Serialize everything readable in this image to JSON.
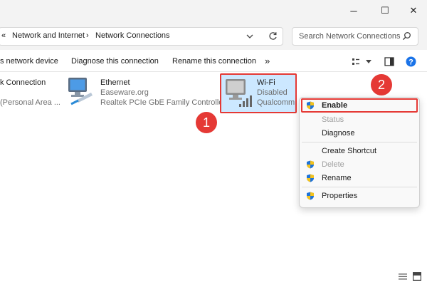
{
  "window": {
    "minimize_glyph": "─",
    "maximize_glyph": "☐",
    "close_glyph": "✕"
  },
  "address": {
    "overflow_glyph": "«",
    "crumbs": [
      "Network and Internet",
      "Network Connections"
    ],
    "separator": "›",
    "search_placeholder": "Search Network Connections"
  },
  "toolbar": {
    "items": [
      "s network device",
      "Diagnose this connection",
      "Rename this connection"
    ],
    "more_glyph": "»"
  },
  "connections": [
    {
      "name": "k Connection",
      "line2": "(Personal Area ..."
    },
    {
      "name": "Ethernet",
      "line2": "Easeware.org",
      "line3": "Realtek PCIe GbE Family Controller"
    },
    {
      "name": "Wi-Fi",
      "line2": "Disabled",
      "line3": "Qualcomm"
    }
  ],
  "annotations": {
    "step1": "1",
    "step2": "2"
  },
  "context_menu": {
    "enable": "Enable",
    "status": "Status",
    "diagnose": "Diagnose",
    "create_shortcut": "Create Shortcut",
    "delete": "Delete",
    "rename": "Rename",
    "properties": "Properties"
  },
  "colors": {
    "selection": "#cce8ff",
    "highlight": "#e53935",
    "disabled_text": "#a0a0a0",
    "help": "#1a73e8"
  }
}
